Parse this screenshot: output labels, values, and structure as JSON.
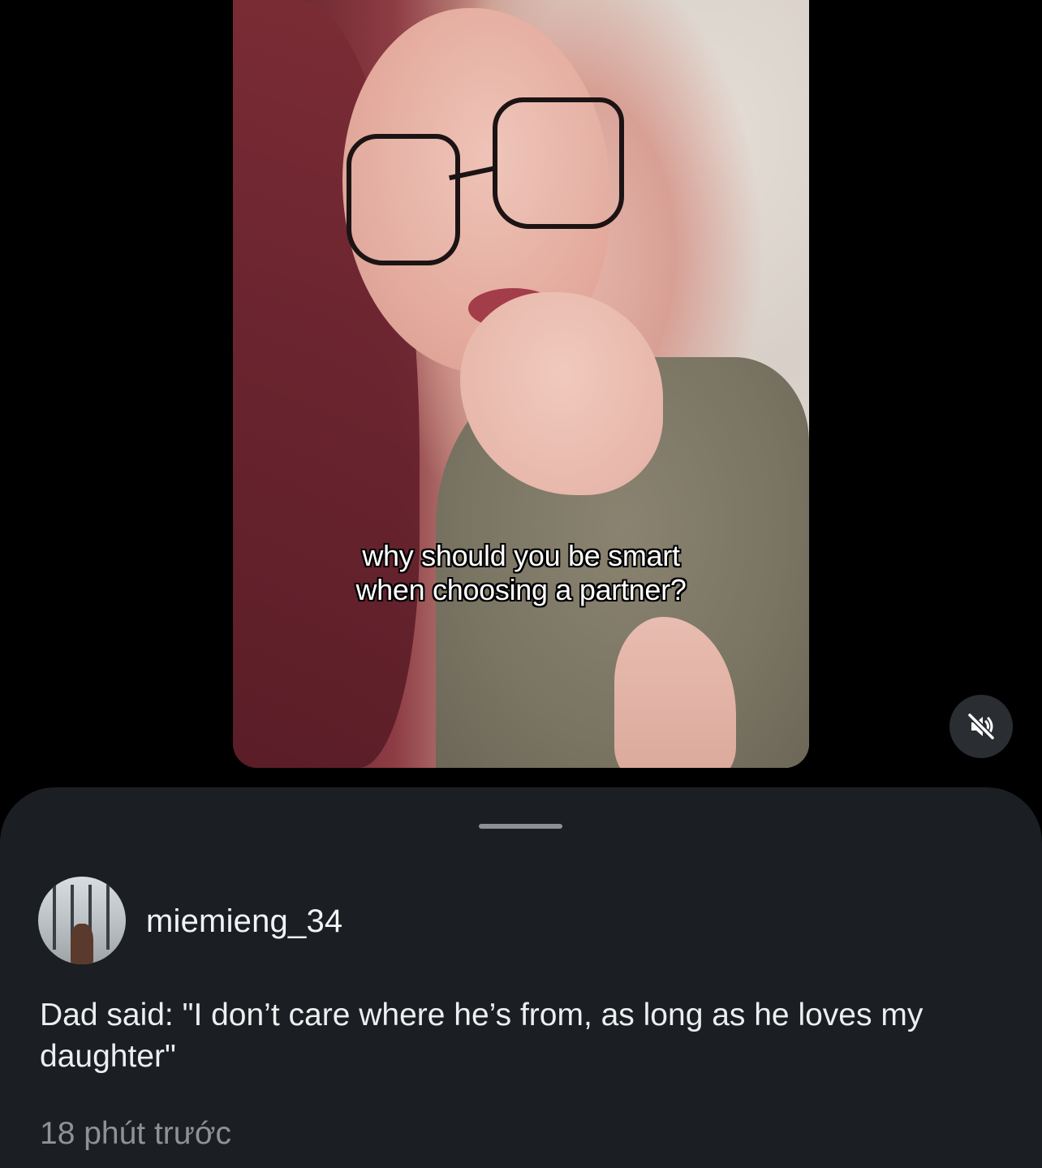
{
  "video": {
    "caption_line1": "why should you be smart",
    "caption_line2": "when choosing a partner?",
    "sound_state": "muted",
    "mute_icon": "speaker-muted-icon"
  },
  "comment_sheet": {
    "author": {
      "username": "miemieng_34",
      "avatar_icon": "profile-photo"
    },
    "text": "Dad said: \"I don’t care where he’s from, as long as he loves my daughter\"",
    "timestamp": "18 phút trước"
  },
  "colors": {
    "page_background": "#000000",
    "sheet_background": "#1b1e22",
    "primary_text": "#f2f3f5",
    "secondary_text": "#8e9297",
    "mute_button_bg": "#2a2d32"
  }
}
